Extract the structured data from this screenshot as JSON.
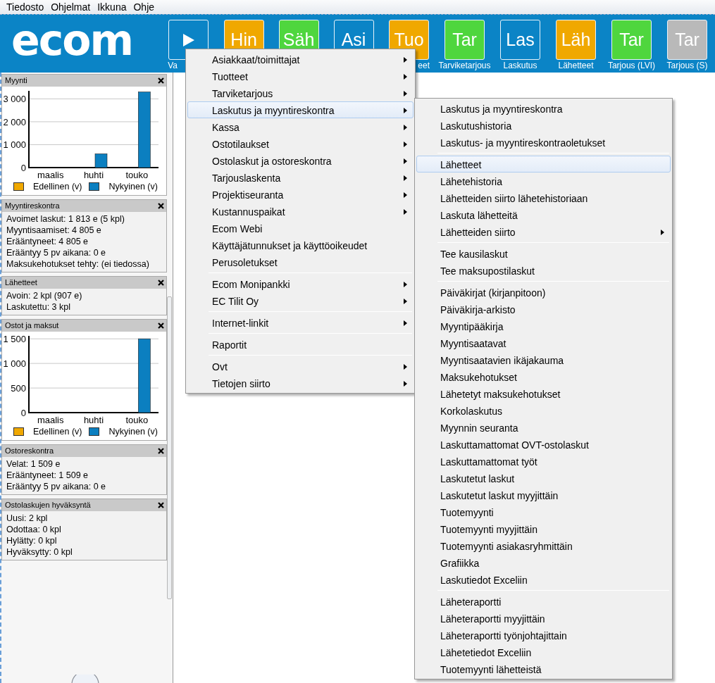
{
  "menubar": [
    "Tiedosto",
    "Ohjelmat",
    "Ikkuna",
    "Ohje"
  ],
  "toolbar": {
    "logo": "ecom",
    "tiles": [
      {
        "kind": "play",
        "color": "#0b84c6",
        "label_head": "Va"
      },
      {
        "kind": "text",
        "text": "Hin",
        "color": "#f0a800"
      },
      {
        "kind": "text",
        "text": "Säh",
        "color": "#4fd63e"
      },
      {
        "kind": "text",
        "text": "Asi",
        "color": "#0b84c6"
      },
      {
        "kind": "text",
        "text": "Tuo",
        "color": "#f0a800",
        "label_tail": "eet"
      },
      {
        "kind": "text",
        "text": "Tar",
        "color": "#4fd63e",
        "label": "Tarviketarjous"
      },
      {
        "kind": "text",
        "text": "Las",
        "color": "#0b84c6",
        "label": "Laskutus"
      },
      {
        "kind": "text",
        "text": "Läh",
        "color": "#f0a800",
        "label": "Lähetteet"
      },
      {
        "kind": "text",
        "text": "Tar",
        "color": "#4fd63e",
        "label": "Tarjous (LVI)"
      },
      {
        "kind": "text",
        "text": "Tar",
        "color": "#b9b9b9",
        "label": "Tarjous (S)"
      }
    ]
  },
  "widgets": [
    {
      "title": "Myynti",
      "kind": "chart",
      "chart_data": {
        "type": "bar",
        "grid": true,
        "categories": [
          "maalis",
          "huhti",
          "touko"
        ],
        "ylim": [
          0,
          3350
        ],
        "yticks": [
          {
            "value": 0,
            "label": "0"
          },
          {
            "value": 1000,
            "label": "1 000"
          },
          {
            "value": 2000,
            "label": "2 000"
          },
          {
            "value": 3000,
            "label": "3 000"
          }
        ],
        "series": [
          {
            "name": "Edellinen (v)",
            "color": "#f0a800",
            "values": [
              0,
              0,
              0
            ]
          },
          {
            "name": "Nykyinen (v)",
            "color": "#0b7fc0",
            "values": [
              0,
              600,
              3300
            ]
          }
        ]
      }
    },
    {
      "title": "Myyntireskontra",
      "kind": "text",
      "lines": [
        "Avoimet laskut: 1 813 e (5 kpl)",
        "Myyntisaamiset: 4 805 e",
        "Erääntyneet: 4 805 e",
        "Erääntyy 5 pv aikana: 0 e",
        "Maksukehotukset tehty: (ei tiedossa)"
      ]
    },
    {
      "title": "Lähetteet",
      "kind": "text",
      "lines": [
        "Avoin: 2 kpl (907 e)",
        "Laskutettu: 3 kpl"
      ]
    },
    {
      "title": "Ostot ja maksut",
      "kind": "chart",
      "chart_data": {
        "type": "bar",
        "grid": true,
        "categories": [
          "maalis",
          "huhti",
          "touko"
        ],
        "ylim": [
          0,
          1560
        ],
        "yticks": [
          {
            "value": 0,
            "label": "0"
          },
          {
            "value": 500,
            "label": "500"
          },
          {
            "value": 1000,
            "label": "1 000"
          },
          {
            "value": 1500,
            "label": "1 500"
          }
        ],
        "series": [
          {
            "name": "Edellinen (v)",
            "color": "#f0a800",
            "values": [
              0,
              0,
              0
            ]
          },
          {
            "name": "Nykyinen (v)",
            "color": "#0b7fc0",
            "values": [
              0,
              0,
              1500
            ]
          }
        ]
      }
    },
    {
      "title": "Ostoreskontra",
      "kind": "text",
      "lines": [
        "Velat: 1 509 e",
        "Erääntyneet: 1 509 e",
        "Erääntyy 5 pv aikana: 0 e"
      ]
    },
    {
      "title": "Ostolaskujen hyväksyntä",
      "kind": "text",
      "lines": [
        "Uusi: 2 kpl",
        "Odottaa: 0 kpl",
        "Hylätty: 0 kpl",
        "Hyväksytty: 0 kpl"
      ]
    }
  ],
  "main_menu": [
    [
      {
        "label": "Asiakkaat/toimittajat",
        "submenu": true,
        "selected": false
      },
      {
        "label": "Tuotteet",
        "submenu": true,
        "selected": false
      },
      {
        "label": "Tarviketarjous",
        "submenu": true,
        "selected": false
      },
      {
        "label": "Laskutus ja myyntireskontra",
        "submenu": true,
        "selected": true
      },
      {
        "label": "Kassa",
        "submenu": true,
        "selected": false
      },
      {
        "label": "Ostotilaukset",
        "submenu": true,
        "selected": false
      },
      {
        "label": "Ostolaskut ja ostoreskontra",
        "submenu": true,
        "selected": false
      },
      {
        "label": "Tarjouslaskenta",
        "submenu": true,
        "selected": false
      },
      {
        "label": "Projektiseuranta",
        "submenu": true,
        "selected": false
      },
      {
        "label": "Kustannuspaikat",
        "submenu": true,
        "selected": false
      },
      {
        "label": "Ecom Webi",
        "submenu": false,
        "selected": false
      },
      {
        "label": "Käyttäjätunnukset ja käyttöoikeudet",
        "submenu": false,
        "selected": false
      },
      {
        "label": "Perusoletukset",
        "submenu": false,
        "selected": false
      }
    ],
    [
      {
        "label": "Ecom Monipankki",
        "submenu": true,
        "selected": false
      },
      {
        "label": "EC Tilit Oy",
        "submenu": true,
        "selected": false
      }
    ],
    [
      {
        "label": "Internet-linkit",
        "submenu": true,
        "selected": false
      }
    ],
    [
      {
        "label": "Raportit",
        "submenu": false,
        "selected": false
      }
    ],
    [
      {
        "label": "Ovt",
        "submenu": true,
        "selected": false
      },
      {
        "label": "Tietojen siirto",
        "submenu": true,
        "selected": false
      }
    ]
  ],
  "submenu": [
    [
      {
        "label": "Laskutus ja myyntireskontra",
        "submenu": false,
        "selected": false
      },
      {
        "label": "Laskutushistoria",
        "submenu": false,
        "selected": false
      },
      {
        "label": "Laskutus- ja myyntireskontraoletukset",
        "submenu": false,
        "selected": false
      }
    ],
    [
      {
        "label": "Lähetteet",
        "submenu": false,
        "selected": true
      },
      {
        "label": "Lähetehistoria",
        "submenu": false,
        "selected": false
      },
      {
        "label": "Lähetteiden siirto lähetehistoriaan",
        "submenu": false,
        "selected": false
      },
      {
        "label": "Laskuta lähetteitä",
        "submenu": false,
        "selected": false
      },
      {
        "label": "Lähetteiden siirto",
        "submenu": true,
        "selected": false
      }
    ],
    [
      {
        "label": "Tee kausilaskut",
        "submenu": false,
        "selected": false
      },
      {
        "label": "Tee maksupostilaskut",
        "submenu": false,
        "selected": false
      }
    ],
    [
      {
        "label": "Päiväkirjat (kirjanpitoon)",
        "submenu": false,
        "selected": false
      },
      {
        "label": "Päiväkirja-arkisto",
        "submenu": false,
        "selected": false
      },
      {
        "label": "Myyntipääkirja",
        "submenu": false,
        "selected": false
      },
      {
        "label": "Myyntisaatavat",
        "submenu": false,
        "selected": false
      },
      {
        "label": "Myyntisaatavien ikäjakauma",
        "submenu": false,
        "selected": false
      },
      {
        "label": "Maksukehotukset",
        "submenu": false,
        "selected": false
      },
      {
        "label": "Lähetetyt maksukehotukset",
        "submenu": false,
        "selected": false
      },
      {
        "label": "Korkolaskutus",
        "submenu": false,
        "selected": false
      },
      {
        "label": "Myynnin seuranta",
        "submenu": false,
        "selected": false
      },
      {
        "label": "Laskuttamattomat OVT-ostolaskut",
        "submenu": false,
        "selected": false
      },
      {
        "label": "Laskuttamattomat työt",
        "submenu": false,
        "selected": false
      },
      {
        "label": "Laskutetut laskut",
        "submenu": false,
        "selected": false
      },
      {
        "label": "Laskutetut laskut myyjittäin",
        "submenu": false,
        "selected": false
      },
      {
        "label": "Tuotemyynti",
        "submenu": false,
        "selected": false
      },
      {
        "label": "Tuotemyynti myyjittäin",
        "submenu": false,
        "selected": false
      },
      {
        "label": "Tuotemyynti asiakasryhmittäin",
        "submenu": false,
        "selected": false
      },
      {
        "label": "Grafiikka",
        "submenu": false,
        "selected": false
      },
      {
        "label": "Laskutiedot Exceliin",
        "submenu": false,
        "selected": false
      }
    ],
    [
      {
        "label": "Läheteraportti",
        "submenu": false,
        "selected": false
      },
      {
        "label": "Läheteraportti myyjittäin",
        "submenu": false,
        "selected": false
      },
      {
        "label": "Läheteraportti työnjohtajittain",
        "submenu": false,
        "selected": false
      },
      {
        "label": "Lähetetiedot Exceliin",
        "submenu": false,
        "selected": false
      },
      {
        "label": "Tuotemyynti lähetteistä",
        "submenu": false,
        "selected": false
      }
    ]
  ]
}
